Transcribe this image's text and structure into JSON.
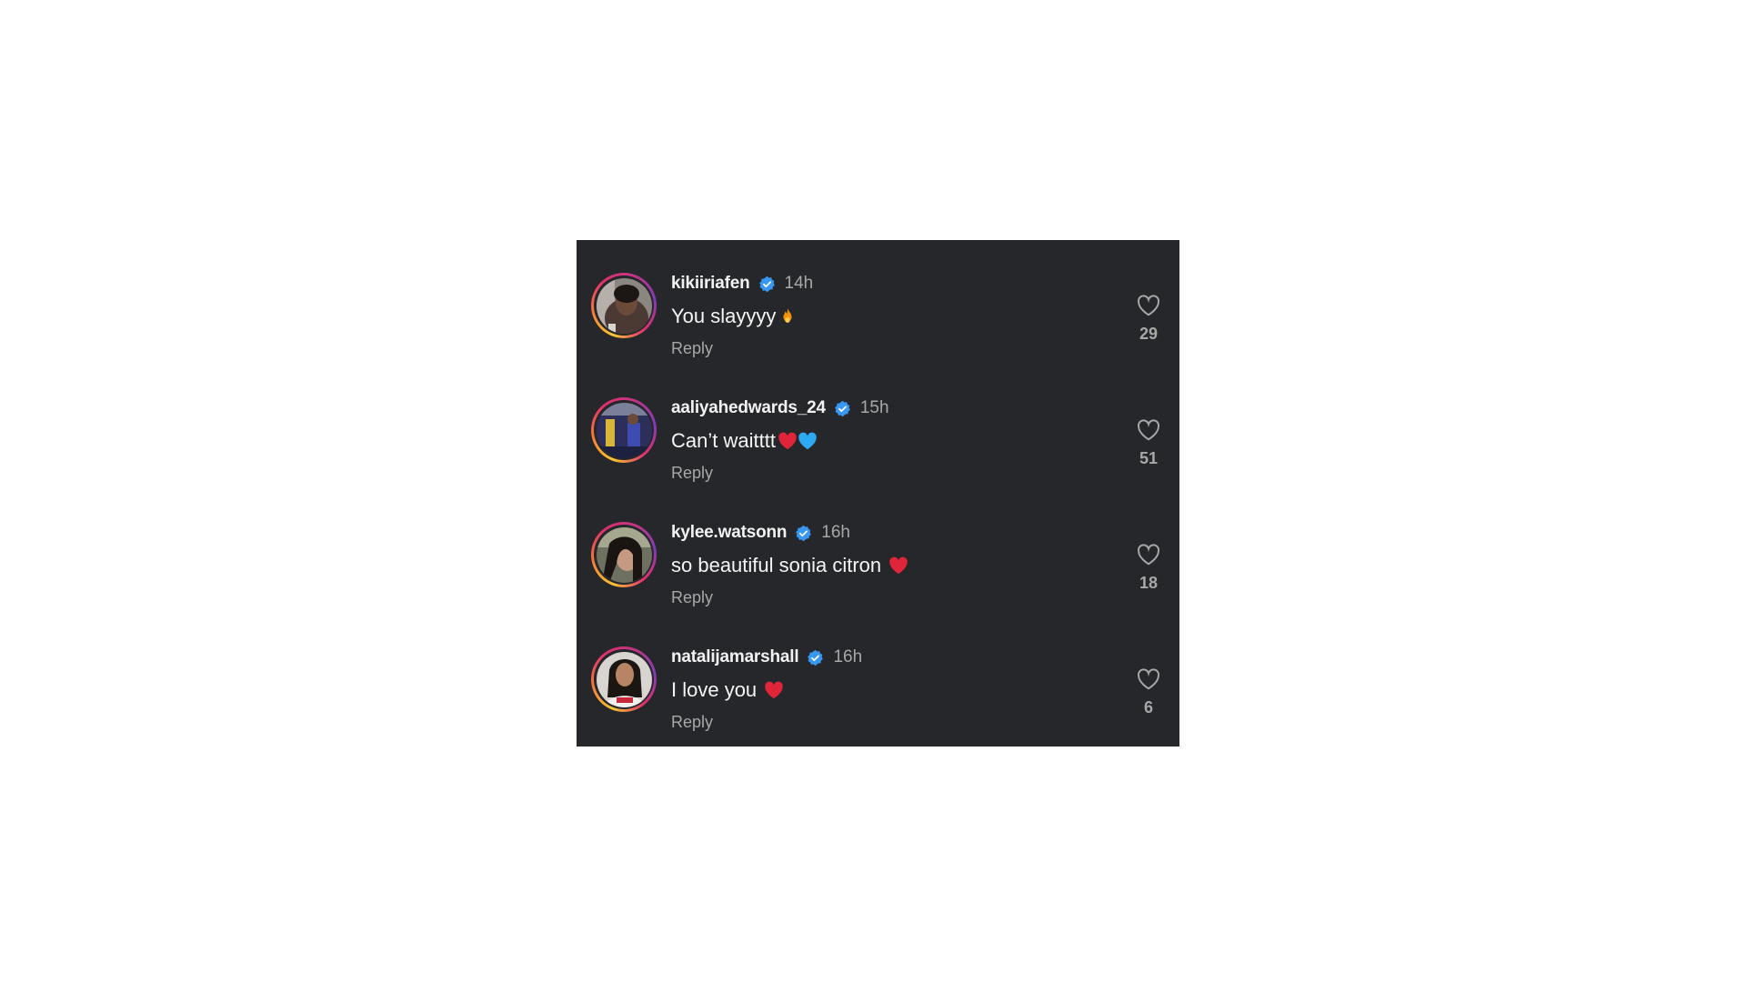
{
  "colors": {
    "background": "#25272b",
    "username": "#f2f2f2",
    "muted": "#a8a8a8",
    "verified": "#3897f0",
    "heart_red": "#e0243a",
    "heart_blue": "#2ea8f0"
  },
  "reply_label": "Reply",
  "comments": [
    {
      "username": "kikiiriafen",
      "verified": true,
      "time": "14h",
      "text": "You slayyyy",
      "emojis": [
        "fire-emoji"
      ],
      "likes": "29"
    },
    {
      "username": "aaliyahedwards_24",
      "verified": true,
      "time": "15h",
      "text": "Can’t waitttt",
      "emojis": [
        "red-heart-emoji",
        "blue-heart-emoji"
      ],
      "likes": "51"
    },
    {
      "username": "kylee.watsonn",
      "verified": true,
      "time": "16h",
      "text": "so beautiful sonia citron ",
      "emojis": [
        "red-heart-emoji"
      ],
      "likes": "18"
    },
    {
      "username": "natalijamarshall",
      "verified": true,
      "time": "16h",
      "text": "I love you ",
      "emojis": [
        "red-heart-emoji"
      ],
      "likes": "6"
    }
  ]
}
